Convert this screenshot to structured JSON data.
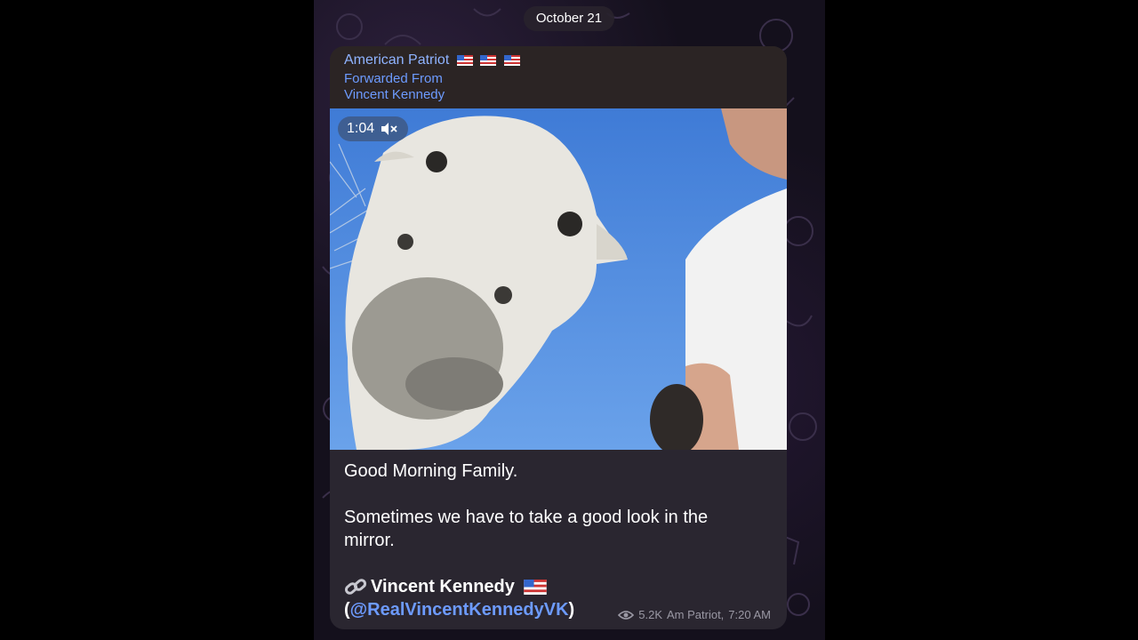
{
  "date_label": "October 21",
  "post": {
    "sender": "American Patriot",
    "forwarded_label": "Forwarded From",
    "forwarded_from": "Vincent Kennedy",
    "video": {
      "duration": "1:04",
      "muted_icon": "speaker-muted-icon"
    },
    "text_line1": "Good Morning Family.",
    "text_line2": "Sometimes we have to take a good look in the",
    "text_line3": "mirror.",
    "signature_name": "Vincent Kennedy",
    "handle_open": "(",
    "handle": "@RealVincentKennedyVK",
    "handle_close": ")",
    "views": "5.2K",
    "author": "Am Patriot,",
    "time": "7:20 AM"
  },
  "colors": {
    "bubble": "#2a2630",
    "header": "#2b2424",
    "link": "#6d9bff",
    "sender": "#8fb3ff",
    "meta": "#9a98a4"
  }
}
